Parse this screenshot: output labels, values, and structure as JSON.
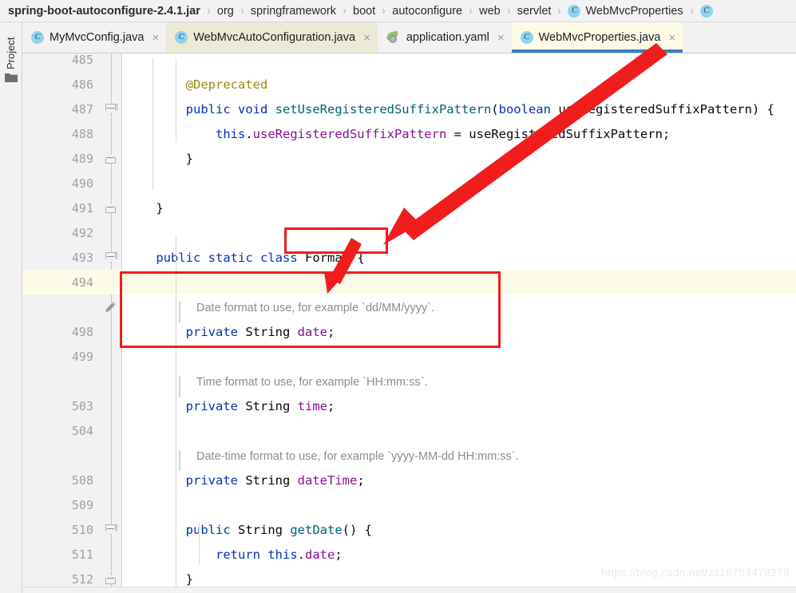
{
  "breadcrumb": {
    "name": "breadcrumb",
    "items": [
      {
        "label": "spring-boot-autoconfigure-2.4.1.jar",
        "bold": true,
        "icon": null
      },
      {
        "label": "org",
        "bold": false,
        "icon": null
      },
      {
        "label": "springframework",
        "bold": false,
        "icon": null
      },
      {
        "label": "boot",
        "bold": false,
        "icon": null
      },
      {
        "label": "autoconfigure",
        "bold": false,
        "icon": null
      },
      {
        "label": "web",
        "bold": false,
        "icon": null
      },
      {
        "label": "servlet",
        "bold": false,
        "icon": null
      },
      {
        "label": "WebMvcProperties",
        "bold": false,
        "icon": "java-class-icon"
      },
      {
        "label": "",
        "bold": false,
        "icon": "java-class-icon"
      }
    ],
    "separator": "›"
  },
  "toolstrip": {
    "project_label": "Project",
    "folder_icon": "folder-icon"
  },
  "tabs": [
    {
      "label": "MyMvcConfig.java",
      "icon": "java-class-icon",
      "active": false,
      "tinted": false,
      "close": "×"
    },
    {
      "label": "WebMvcAutoConfiguration.java",
      "icon": "java-class-icon",
      "active": false,
      "tinted": true,
      "close": "×"
    },
    {
      "label": "application.yaml",
      "icon": "spring-yaml-icon",
      "active": false,
      "tinted": false,
      "close": "×"
    },
    {
      "label": "WebMvcProperties.java",
      "icon": "java-class-icon",
      "active": true,
      "tinted": false,
      "close": "×"
    }
  ],
  "editor": {
    "accent_active_tab": "#3b7dbd",
    "highlight_line_color": "#fdfbe8",
    "annotation_color": "#f01d1d",
    "lines": [
      {
        "num": "485",
        "fold": null,
        "type": "blank",
        "tokens": []
      },
      {
        "num": "486",
        "fold": null,
        "type": "code",
        "indent": 0,
        "tokens": [
          {
            "t": "        ",
            "c": "punct"
          },
          {
            "t": "@Deprecated",
            "c": "anno"
          }
        ]
      },
      {
        "num": "487",
        "fold": "open",
        "type": "code",
        "indent": 0,
        "tokens": [
          {
            "t": "        ",
            "c": "punct"
          },
          {
            "t": "public",
            "c": "kw"
          },
          {
            "t": " ",
            "c": "punct"
          },
          {
            "t": "void",
            "c": "kw"
          },
          {
            "t": " ",
            "c": "punct"
          },
          {
            "t": "setUseRegisteredSuffixPattern",
            "c": "fn"
          },
          {
            "t": "(",
            "c": "punct"
          },
          {
            "t": "boolean",
            "c": "kw"
          },
          {
            "t": " ",
            "c": "punct"
          },
          {
            "t": "useRegisteredSuffixPattern",
            "c": "type"
          },
          {
            "t": ") {",
            "c": "punct"
          }
        ]
      },
      {
        "num": "488",
        "fold": null,
        "type": "code",
        "indent": 0,
        "tokens": [
          {
            "t": "            ",
            "c": "punct"
          },
          {
            "t": "this",
            "c": "kw"
          },
          {
            "t": ".",
            "c": "punct"
          },
          {
            "t": "useRegisteredSuffixPattern",
            "c": "field"
          },
          {
            "t": " = useRegisteredSuffixPattern;",
            "c": "type"
          }
        ]
      },
      {
        "num": "489",
        "fold": "close",
        "type": "code",
        "indent": 0,
        "tokens": [
          {
            "t": "        }",
            "c": "punct"
          }
        ]
      },
      {
        "num": "490",
        "fold": null,
        "type": "blank",
        "tokens": []
      },
      {
        "num": "491",
        "fold": "close",
        "type": "code",
        "indent": 0,
        "tokens": [
          {
            "t": "    }",
            "c": "punct"
          }
        ]
      },
      {
        "num": "492",
        "fold": null,
        "type": "blank",
        "tokens": []
      },
      {
        "num": "493",
        "fold": "open",
        "type": "code",
        "indent": 0,
        "tokens": [
          {
            "t": "    ",
            "c": "punct"
          },
          {
            "t": "public",
            "c": "kw"
          },
          {
            "t": " ",
            "c": "punct"
          },
          {
            "t": "static",
            "c": "kw"
          },
          {
            "t": " ",
            "c": "punct"
          },
          {
            "t": "class",
            "c": "kw"
          },
          {
            "t": " ",
            "c": "punct"
          },
          {
            "t": "Format",
            "c": "type"
          },
          {
            "t": " {",
            "c": "punct"
          }
        ]
      },
      {
        "num": "494",
        "fold": null,
        "type": "blank",
        "highlight": true,
        "tokens": []
      },
      {
        "num": "",
        "fold": "pencil",
        "type": "jdoc",
        "jdoc": "Date format to use, for example `dd/MM/yyyy`."
      },
      {
        "num": "498",
        "fold": null,
        "type": "code",
        "indent": 0,
        "tokens": [
          {
            "t": "        ",
            "c": "punct"
          },
          {
            "t": "private",
            "c": "kw"
          },
          {
            "t": " ",
            "c": "punct"
          },
          {
            "t": "String",
            "c": "type"
          },
          {
            "t": " ",
            "c": "punct"
          },
          {
            "t": "date",
            "c": "field"
          },
          {
            "t": ";",
            "c": "punct"
          }
        ]
      },
      {
        "num": "499",
        "fold": null,
        "type": "blank",
        "tokens": []
      },
      {
        "num": "",
        "fold": null,
        "type": "jdoc",
        "jdoc": "Time format to use, for example `HH:mm:ss`."
      },
      {
        "num": "503",
        "fold": null,
        "type": "code",
        "indent": 0,
        "tokens": [
          {
            "t": "        ",
            "c": "punct"
          },
          {
            "t": "private",
            "c": "kw"
          },
          {
            "t": " ",
            "c": "punct"
          },
          {
            "t": "String",
            "c": "type"
          },
          {
            "t": " ",
            "c": "punct"
          },
          {
            "t": "time",
            "c": "field"
          },
          {
            "t": ";",
            "c": "punct"
          }
        ]
      },
      {
        "num": "504",
        "fold": null,
        "type": "blank",
        "tokens": []
      },
      {
        "num": "",
        "fold": null,
        "type": "jdoc",
        "jdoc": "Date-time format to use, for example `yyyy-MM-dd HH:mm:ss`."
      },
      {
        "num": "508",
        "fold": null,
        "type": "code",
        "indent": 0,
        "tokens": [
          {
            "t": "        ",
            "c": "punct"
          },
          {
            "t": "private",
            "c": "kw"
          },
          {
            "t": " ",
            "c": "punct"
          },
          {
            "t": "String",
            "c": "type"
          },
          {
            "t": " ",
            "c": "punct"
          },
          {
            "t": "dateTime",
            "c": "field"
          },
          {
            "t": ";",
            "c": "punct"
          }
        ]
      },
      {
        "num": "509",
        "fold": null,
        "type": "blank",
        "tokens": []
      },
      {
        "num": "510",
        "fold": "open",
        "type": "code",
        "indent": 0,
        "tokens": [
          {
            "t": "        ",
            "c": "punct"
          },
          {
            "t": "public",
            "c": "kw"
          },
          {
            "t": " ",
            "c": "punct"
          },
          {
            "t": "String",
            "c": "type"
          },
          {
            "t": " ",
            "c": "punct"
          },
          {
            "t": "getDate",
            "c": "fn"
          },
          {
            "t": "() {",
            "c": "punct"
          }
        ]
      },
      {
        "num": "511",
        "fold": null,
        "type": "code",
        "indent": 0,
        "tokens": [
          {
            "t": "            ",
            "c": "punct"
          },
          {
            "t": "return",
            "c": "kw"
          },
          {
            "t": " ",
            "c": "punct"
          },
          {
            "t": "this",
            "c": "kw"
          },
          {
            "t": ".",
            "c": "punct"
          },
          {
            "t": "date",
            "c": "field"
          },
          {
            "t": ";",
            "c": "punct"
          }
        ]
      },
      {
        "num": "512",
        "fold": "close",
        "type": "code",
        "indent": 0,
        "tokens": [
          {
            "t": "        }",
            "c": "punct"
          }
        ]
      }
    ]
  },
  "annotations": {
    "format_box_label": "Format {",
    "date_box_label": "private String date;",
    "arrows": 2
  },
  "watermark": {
    "text": "https://blog.csdn.net/zs18753479279"
  }
}
